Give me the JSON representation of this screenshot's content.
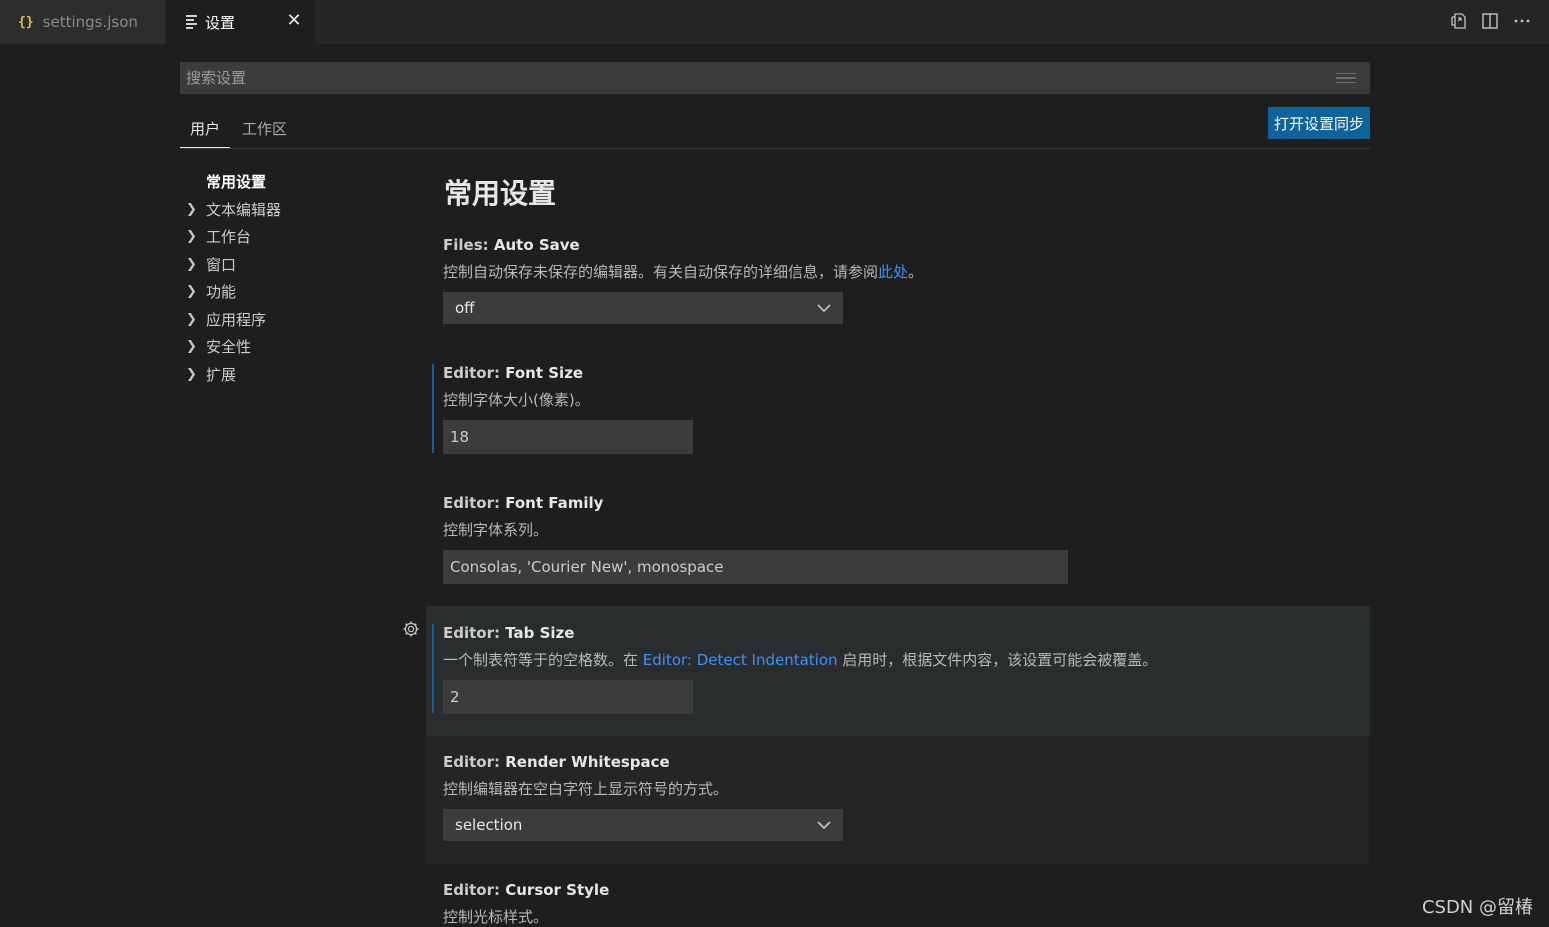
{
  "tabs": {
    "file_tab": {
      "icon_text": "{}",
      "label": "settings.json"
    },
    "settings_tab": {
      "label": "设置"
    }
  },
  "search": {
    "placeholder": "搜索设置"
  },
  "scopes": {
    "user": "用户",
    "workspace": "工作区"
  },
  "sync_button": "打开设置同步",
  "toc": {
    "selected": "常用设置",
    "items": [
      "文本编辑器",
      "工作台",
      "窗口",
      "功能",
      "应用程序",
      "安全性",
      "扩展"
    ]
  },
  "section_title": "常用设置",
  "settings": {
    "auto_save": {
      "category": "Files: ",
      "key": "Auto Save",
      "desc": "控制自动保存未保存的编辑器。有关自动保存的详细信息，请参阅",
      "link": "此处",
      "desc_end": "。",
      "value": "off"
    },
    "font_size": {
      "category": "Editor: ",
      "key": "Font Size",
      "desc": "控制字体大小(像素)。",
      "value": "18"
    },
    "font_family": {
      "category": "Editor: ",
      "key": "Font Family",
      "desc": "控制字体系列。",
      "value": "Consolas, 'Courier New', monospace"
    },
    "tab_size": {
      "category": "Editor: ",
      "key": "Tab Size",
      "desc": "一个制表符等于的空格数。在 ",
      "link": "Editor: Detect Indentation",
      "desc_end": " 启用时，根据文件内容，该设置可能会被覆盖。",
      "value": "2"
    },
    "render_whitespace": {
      "category": "Editor: ",
      "key": "Render Whitespace",
      "desc": "控制编辑器在空白字符上显示符号的方式。",
      "value": "selection"
    },
    "cursor_style": {
      "category": "Editor: ",
      "key": "Cursor Style",
      "desc": "控制光标样式。"
    }
  },
  "watermark": "CSDN @留椿",
  "colors": {
    "accent": "#0e639c",
    "link": "#3794ff",
    "background": "#1e1e1e"
  }
}
